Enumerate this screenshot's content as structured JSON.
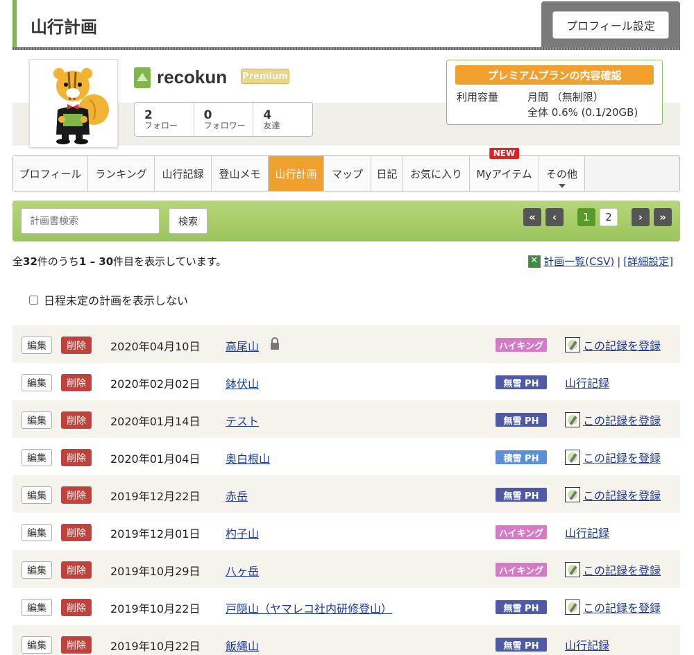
{
  "header": {
    "title": "山行計画",
    "settings_button": "プロフィール設定"
  },
  "profile": {
    "username": "recokun",
    "badge": "Premium",
    "stats": [
      {
        "num": "2",
        "label": "フォロー"
      },
      {
        "num": "0",
        "label": "フォロワー"
      },
      {
        "num": "4",
        "label": "友達"
      }
    ],
    "premium_box": {
      "heading": "プレミアムプランの内容確認",
      "label": "利用容量",
      "line1": "月間 （無制限）",
      "line2": "全体 0.6% (0.1/20GB)"
    }
  },
  "tabs": [
    {
      "label": "プロフィール",
      "width": 108
    },
    {
      "label": "ランキング",
      "width": 96
    },
    {
      "label": "山行記録",
      "width": 82
    },
    {
      "label": "登山メモ",
      "width": 82
    },
    {
      "label": "山行計画",
      "width": 80,
      "active": true
    },
    {
      "label": "マップ",
      "width": 68
    },
    {
      "label": "日記",
      "width": 46
    },
    {
      "label": "お気に入り",
      "width": 96
    },
    {
      "label": "Myアイテム",
      "width": 100,
      "new": "NEW"
    },
    {
      "label": "その他",
      "width": 66,
      "caret": true
    }
  ],
  "search": {
    "placeholder": "計画書検索",
    "button": "検索"
  },
  "pager": {
    "first": "«",
    "prev": "‹",
    "pages": [
      "1",
      "2"
    ],
    "next": "›",
    "last": "»"
  },
  "summary": {
    "prefix": "全",
    "total": "32",
    "mid": "件のうち",
    "range": "1 – 30",
    "suffix": "件目を表示しています。"
  },
  "csv": {
    "list_link": "計画一覧(CSV)",
    "sep": "|",
    "detail_link": "[詳細設定]"
  },
  "filter_label": "日程未定の計画を表示しない",
  "plans": [
    {
      "edit": "編集",
      "delete": "削除",
      "date": "2020年04月10日",
      "name": "高尾山",
      "locked": true,
      "tag": "ハイキング",
      "tag_type": "hiking",
      "record": "この記録を登録",
      "record_icon": true
    },
    {
      "edit": "編集",
      "delete": "削除",
      "date": "2020年02月02日",
      "name": "鉢伏山",
      "tag": "無雪 PH",
      "tag_type": "nosnow",
      "record": "山行記録",
      "record_icon": false
    },
    {
      "edit": "編集",
      "delete": "削除",
      "date": "2020年01月14日",
      "name": "テスト",
      "tag": "無雪 PH",
      "tag_type": "nosnow",
      "record": "この記録を登録",
      "record_icon": true
    },
    {
      "edit": "編集",
      "delete": "削除",
      "date": "2020年01月04日",
      "name": "奥白根山",
      "tag": "積雪 PH",
      "tag_type": "snow",
      "record": "この記録を登録",
      "record_icon": true
    },
    {
      "edit": "編集",
      "delete": "削除",
      "date": "2019年12月22日",
      "name": "赤岳",
      "tag": "無雪 PH",
      "tag_type": "nosnow",
      "record": "この記録を登録",
      "record_icon": true
    },
    {
      "edit": "編集",
      "delete": "削除",
      "date": "2019年12月01日",
      "name": "杓子山",
      "tag": "ハイキング",
      "tag_type": "hiking",
      "record": "山行記録",
      "record_icon": false
    },
    {
      "edit": "編集",
      "delete": "削除",
      "date": "2019年10月29日",
      "name": "八ヶ岳",
      "tag": "ハイキング",
      "tag_type": "hiking",
      "record": "この記録を登録",
      "record_icon": true
    },
    {
      "edit": "編集",
      "delete": "削除",
      "date": "2019年10月22日",
      "name": "戸隠山（ヤマレコ社内研修登山）",
      "tag": "無雪 PH",
      "tag_type": "nosnow",
      "record": "この記録を登録",
      "record_icon": true
    },
    {
      "edit": "編集",
      "delete": "削除",
      "date": "2019年10月22日",
      "name": "飯縄山",
      "tag": "無雪 PH",
      "tag_type": "nosnow",
      "record": "山行記録",
      "record_icon": false
    }
  ]
}
